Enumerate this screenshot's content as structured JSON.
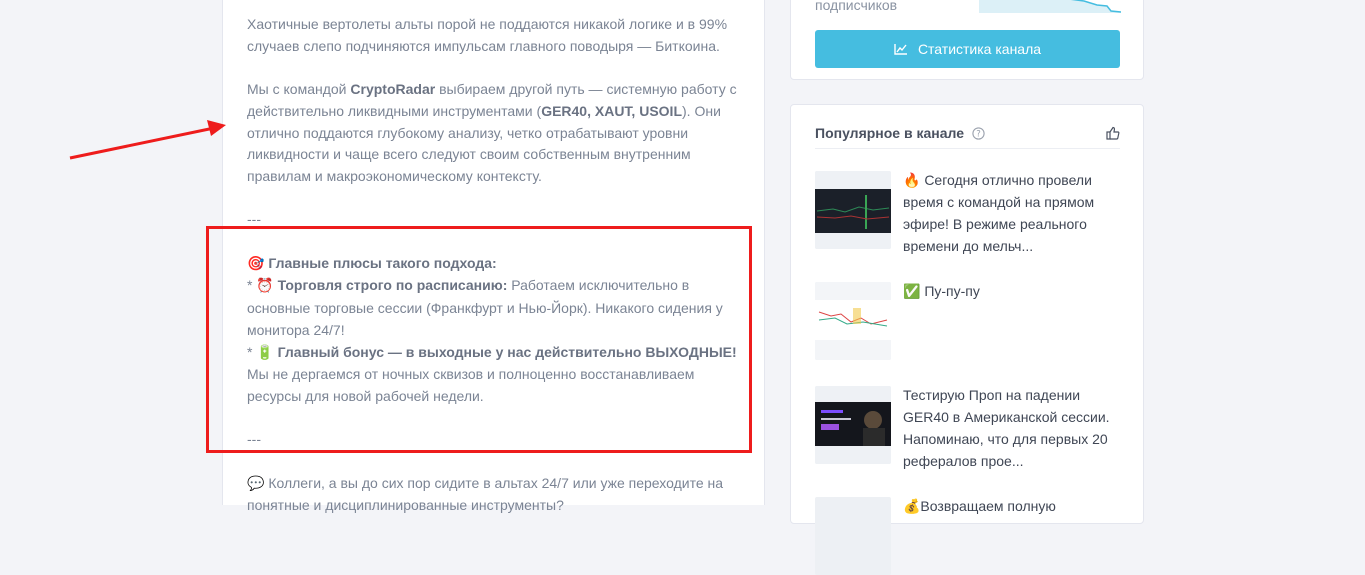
{
  "post": {
    "p1": "Хаотичные вертолеты альты порой не поддаются никакой логике и в 99% случаев слепо подчиняются импульсам главного поводыря — Биткоина.",
    "p2_a": "Мы с командой ",
    "p2_brand": "CryptoRadar",
    "p2_b": " выбираем другой путь — системную работу с действительно ликвидными инструментами (",
    "p2_instr": "GER40, XAUT, USOIL",
    "p2_c": "). Они отлично поддаются глубокому анализу, четко отрабатывают уровни ликвидности и чаще всего следуют своим собственным внутренним правилам и макроэкономическому контексту.",
    "sep": "---",
    "plus_emoji": "🎯",
    "plus_title": "Главные плюсы такого подхода:",
    "bullet": "* ",
    "b1_emoji": "⏰",
    "b1_bold": "Торговля строго по расписанию:",
    "b1_text": " Работаем исключительно в основные торговые сессии (Франкфурт и Нью-Йорк). Никакого сидения у монитора 24/7!",
    "b2_emoji": "🔋",
    "b2_bold": "Главный бонус — в выходные у нас действительно ВЫХОДНЫЕ!",
    "b2_text": "Мы не дергаемся от ночных сквизов и полноценно восстанавливаем ресурсы для новой рабочей недели.",
    "sep2": "---",
    "q_emoji": "💬",
    "question": "Коллеги, а вы до сих пор сидите в альтах 24/7 или уже переходите на понятные и дисциплинированные инструменты?"
  },
  "sidebar": {
    "subscribers_label": "подписчиков",
    "stats_button": "Статистика канала",
    "popular_title": "Популярное в канале",
    "items": [
      {
        "text": "🔥 Сегодня отлично провели время с командой на прямом эфире! В режиме реального времени до мельч..."
      },
      {
        "text": "✅ Пу-пу-пу"
      },
      {
        "text": "Тестирую Проп на падении GER40 в Американской сессии. Напоминаю, что для первых 20 рефералов прое..."
      },
      {
        "text": "💰Возвращаем полную"
      }
    ]
  },
  "colors": {
    "accent_button": "#45bde0",
    "annotation_red": "#ee1c1c"
  }
}
